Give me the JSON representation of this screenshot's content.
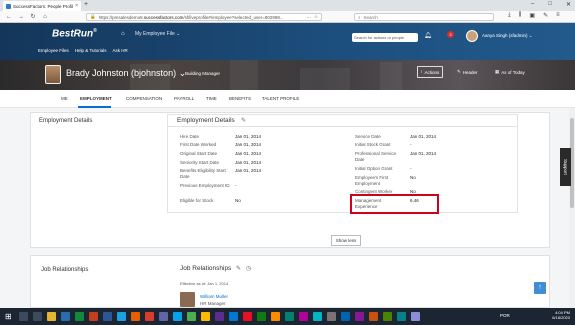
{
  "browser": {
    "tab_title": "SuccessFactors: People Profile",
    "tab_close": "×",
    "new_tab": "+",
    "url_prefix": "https://pmsalesdemo8.",
    "url_domain": "successfactors.com",
    "url_rest": "/sf/liveprofile#/employee?selected_user=802998...",
    "search_placeholder": "Search",
    "window_controls": [
      "–",
      "□",
      "✕"
    ]
  },
  "header": {
    "logo": "BestRun",
    "nav_label": "My Employee File",
    "links": [
      "Employee Files",
      "Help & Tutorials",
      "Ask HR"
    ],
    "search_placeholder": "Search for actions or people",
    "notification_count": "3",
    "user": "Aanya Singh (sfadmin)"
  },
  "profile": {
    "name": "Brady Johnston (bjohnston)",
    "title": "Building Manager",
    "actions_label": "Actions",
    "header_label": "Header",
    "as_of_label": "As of Today"
  },
  "tabs": [
    "ME",
    "EMPLOYMENT",
    "COMPENSATION",
    "PAYROLL",
    "TIME",
    "BENEFITS",
    "TALENT PROFILE"
  ],
  "employment": {
    "section_title": "Employment Details",
    "card_title": "Employment Details",
    "left": [
      {
        "label": "Hire Date",
        "value": "Jan 01, 2014"
      },
      {
        "label": "First Date Worked",
        "value": "Jan 01, 2014"
      },
      {
        "label": "Original Start Date",
        "value": "Jan 01, 2014"
      },
      {
        "label": "Seniority Start Date",
        "value": "Jan 01, 2014"
      },
      {
        "label": "Benefits Eligibility Start Date",
        "value": "Jan 01, 2014"
      },
      {
        "label": "Previous Employment ID",
        "value": "-"
      },
      {
        "label": "Eligible for Stock",
        "value": "No"
      }
    ],
    "right": [
      {
        "label": "Service Date",
        "value": "Jan 01, 2014"
      },
      {
        "label": "Initial Stock Grant",
        "value": "-"
      },
      {
        "label": "Professional Service Date",
        "value": "Jan 01, 2014"
      },
      {
        "label": "Initial Option Grant",
        "value": "-"
      },
      {
        "label": "Employee's First Employment",
        "value": "No"
      },
      {
        "label": "Contingent Worker",
        "value": "No"
      },
      {
        "label": "Management Experience",
        "value": "6.46"
      }
    ],
    "show_less": "Show less"
  },
  "job": {
    "section_title": "Job Relationships",
    "card_title": "Job Relationships",
    "effective": "Effective as of: Jan 1, 2014",
    "person_name": "William Muller",
    "person_role": "HR Manager"
  },
  "support_label": "Support",
  "to_top": "↑",
  "taskbar": {
    "lang": "POR",
    "time": "4:04 PM",
    "date": "6/18/2020"
  },
  "colors": {
    "header_bg": "#1d4f7e",
    "accent": "#0a6ed1",
    "highlight": "#d0021b"
  }
}
